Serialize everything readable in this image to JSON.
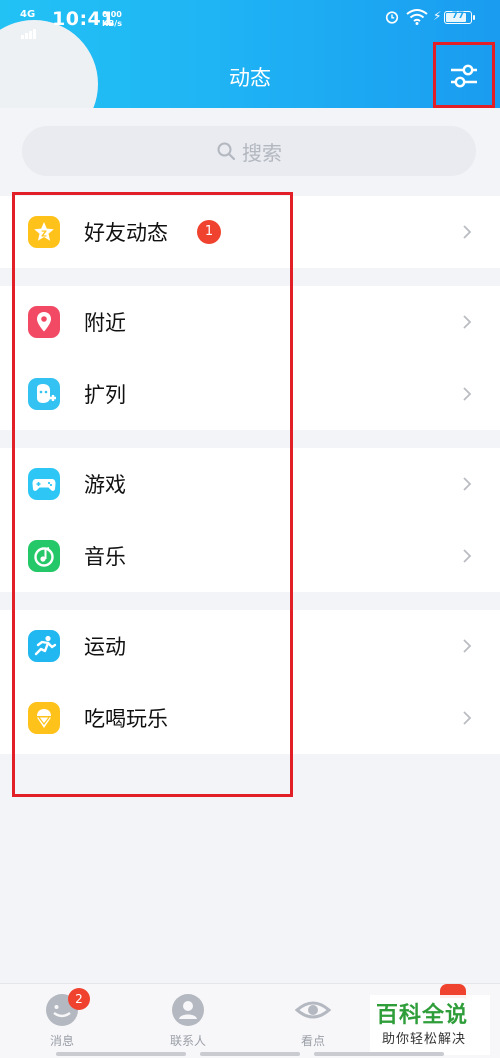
{
  "status_bar": {
    "network_type": "4G",
    "time": "10:41",
    "net_speed_value": "0.00",
    "net_speed_unit": "KB/s",
    "battery": "77"
  },
  "header": {
    "title": "动态",
    "settings_icon": "sliders-icon"
  },
  "search": {
    "placeholder": "搜索",
    "icon": "search-icon"
  },
  "groups": [
    {
      "items": [
        {
          "label": "好友动态",
          "badge": "1",
          "icon": "friends-feed-star-icon",
          "color": "#ffc21a"
        }
      ]
    },
    {
      "items": [
        {
          "label": "附近",
          "icon": "location-pin-icon",
          "color": "#f24a64"
        },
        {
          "label": "扩列",
          "icon": "add-friend-icon",
          "color": "#33c2f2"
        }
      ]
    },
    {
      "items": [
        {
          "label": "游戏",
          "icon": "gamepad-icon",
          "color": "#2ec7f5"
        },
        {
          "label": "音乐",
          "icon": "music-icon",
          "color": "#25c868"
        }
      ]
    },
    {
      "items": [
        {
          "label": "运动",
          "icon": "running-icon",
          "color": "#21b7f0"
        },
        {
          "label": "吃喝玩乐",
          "icon": "ice-cream-icon",
          "color": "#ffc21a"
        }
      ]
    }
  ],
  "tabbar": {
    "tabs": [
      {
        "label": "消息",
        "badge": "2",
        "icon": "message-face-icon"
      },
      {
        "label": "联系人",
        "icon": "contacts-icon"
      },
      {
        "label": "看点",
        "icon": "eye-icon"
      }
    ]
  },
  "watermark": {
    "top": "百科全说",
    "bottom": "助你轻松解决"
  }
}
